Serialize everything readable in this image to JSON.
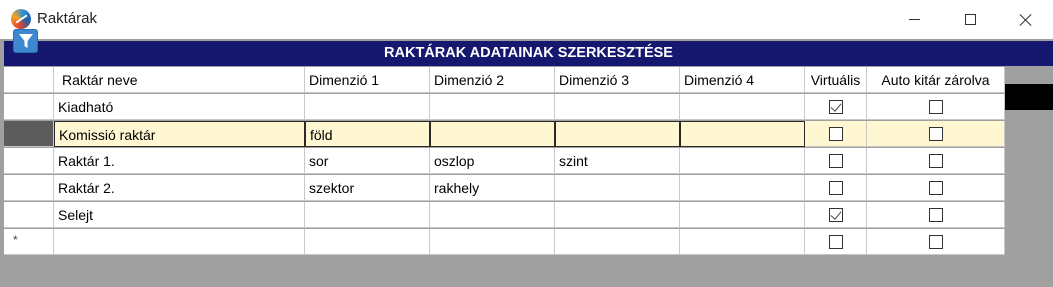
{
  "window": {
    "title": "Raktárak"
  },
  "form": {
    "heading": "RAKTÁRAK ADATAINAK SZERKESZTÉSE"
  },
  "grid": {
    "columns": [
      "Raktár neve",
      "Dimenzió 1",
      "Dimenzió 2",
      "Dimenzió 3",
      "Dimenzió 4",
      "Virtuális",
      "Auto kitár zárolva"
    ],
    "rows": [
      {
        "name": "Kiadható",
        "d1": "",
        "d2": "",
        "d3": "",
        "d4": "",
        "virtual": true,
        "auto_lock": false
      },
      {
        "name": "Komissió raktár",
        "d1": "föld",
        "d2": "",
        "d3": "",
        "d4": "",
        "virtual": false,
        "auto_lock": false
      },
      {
        "name": "Raktár 1.",
        "d1": "sor",
        "d2": "oszlop",
        "d3": "szint",
        "d4": "",
        "virtual": false,
        "auto_lock": false
      },
      {
        "name": "Raktár 2.",
        "d1": "szektor",
        "d2": "rakhely",
        "d3": "",
        "d4": "",
        "virtual": false,
        "auto_lock": false
      },
      {
        "name": "Selejt",
        "d1": "",
        "d2": "",
        "d3": "",
        "d4": "",
        "virtual": true,
        "auto_lock": false
      },
      {
        "name": "",
        "d1": "",
        "d2": "",
        "d3": "",
        "d4": "",
        "virtual": false,
        "auto_lock": false
      }
    ],
    "selected_row": 1,
    "new_row_marker": "*"
  },
  "icons": {
    "app": "app-logo-icon",
    "filter": "filter-icon"
  },
  "colors": {
    "heading_bg": "#16176e",
    "selected_row_bg": "#fef7d2",
    "filter_button": "#3d88d0"
  }
}
